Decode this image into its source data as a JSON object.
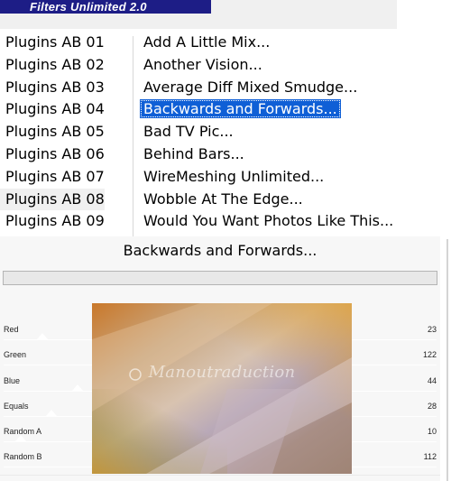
{
  "app": {
    "banner_title": "Filters Unlimited 2.0"
  },
  "categories": [
    {
      "label": "Plugins AB 01"
    },
    {
      "label": "Plugins AB 02"
    },
    {
      "label": "Plugins AB 03"
    },
    {
      "label": "Plugins AB 04"
    },
    {
      "label": "Plugins AB 05"
    },
    {
      "label": "Plugins AB 06"
    },
    {
      "label": "Plugins AB 07"
    },
    {
      "label": "Plugins AB 08",
      "selected": true
    },
    {
      "label": "Plugins AB 09"
    }
  ],
  "filters": [
    {
      "label": "Add A Little Mix..."
    },
    {
      "label": "Another Vision..."
    },
    {
      "label": "Average Diff Mixed Smudge..."
    },
    {
      "label": "Backwards and Forwards...",
      "selected": true
    },
    {
      "label": "Bad TV Pic..."
    },
    {
      "label": "Behind Bars..."
    },
    {
      "label": "WireMeshing Unlimited..."
    },
    {
      "label": "Wobble At The Edge..."
    },
    {
      "label": "Would You Want Photos Like This..."
    }
  ],
  "panel": {
    "title": "Backwards and Forwards..."
  },
  "progress": {
    "fraction": 0
  },
  "sliders": [
    {
      "label": "Red",
      "value": "23",
      "level": 0.09
    },
    {
      "label": "Green",
      "value": "122",
      "level": 0.48
    },
    {
      "label": "Blue",
      "value": "44",
      "level": 0.17
    },
    {
      "label": "Equals",
      "value": "28",
      "level": 0.11
    },
    {
      "label": "Random A",
      "value": "10",
      "level": 0.04
    },
    {
      "label": "Random B",
      "value": "112",
      "level": 0.44
    }
  ],
  "preview": {
    "watermark": "Manoutraduction"
  },
  "colors": {
    "banner": "#1d1d86",
    "selection": "#0f5fd6",
    "panel": "#f7f7f7"
  },
  "icons": {
    "logo": "manoutraduction-logo"
  }
}
